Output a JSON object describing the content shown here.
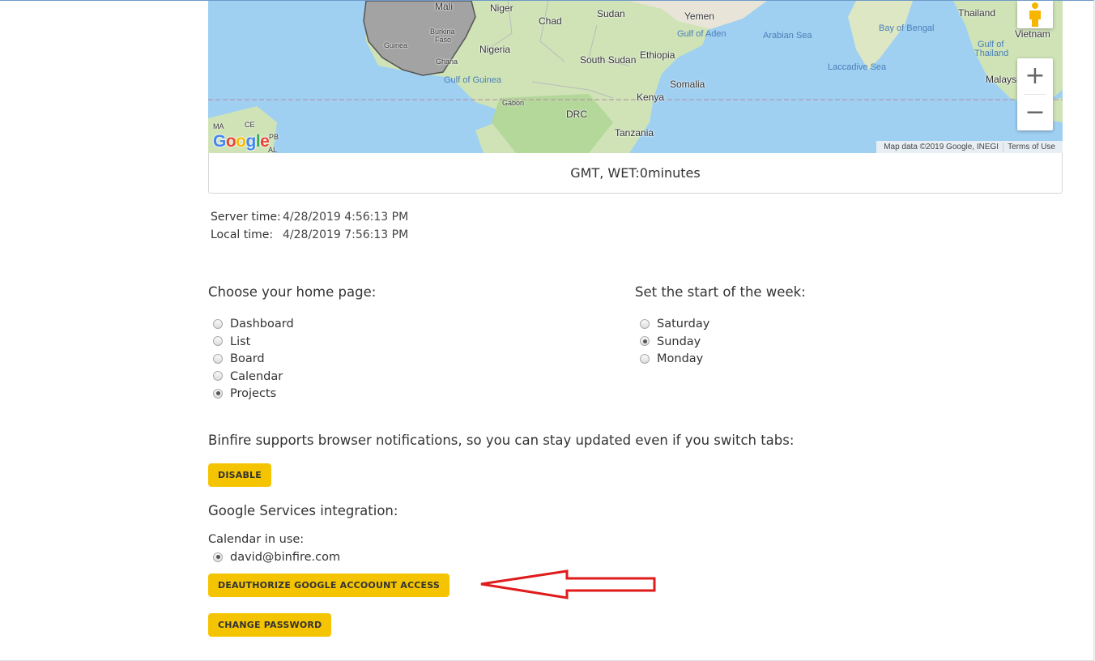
{
  "map": {
    "labels": {
      "mali": "Mali",
      "niger": "Niger",
      "chad": "Chad",
      "sudan": "Sudan",
      "yemen": "Yemen",
      "thailand": "Thailand",
      "gulf_aden": "Gulf of Aden",
      "arabian_sea": "Arabian Sea",
      "bay_bengal": "Bay of Bengal",
      "vietnam": "Vietnam",
      "guinea": "Guinea",
      "burkina": "Burkina",
      "faso": "Faso",
      "nigeria": "Nigeria",
      "ghana": "Ghana",
      "south_sudan": "South Sudan",
      "ethiopia": "Ethiopia",
      "gulf_thailand": "Gulf of",
      "gulf_thailand2": "Thailand",
      "laccadive": "Laccadive Sea",
      "gulf_guinea": "Gulf of Guinea",
      "somalia": "Somalia",
      "malaysia": "Malaysia",
      "gabon": "Gabon",
      "kenya": "Kenya",
      "drc": "DRC",
      "tanzania": "Tanzania",
      "ma": "MA",
      "ce": "CE",
      "pb": "PB",
      "al": "AL"
    },
    "google_logo": [
      "G",
      "o",
      "o",
      "g",
      "l",
      "e"
    ],
    "logo_colors": [
      "#4285F4",
      "#EA4335",
      "#FBBC05",
      "#4285F4",
      "#34A853",
      "#EA4335"
    ],
    "zoom_in": "+",
    "zoom_out": "−",
    "attribution": "Map data ©2019 Google, INEGI",
    "terms": "Terms of Use"
  },
  "timezone": {
    "label": "GMT, WET:0minutes"
  },
  "times": {
    "server_label": "Server time:",
    "server_value": "4/28/2019 4:56:13 PM",
    "local_label": "Local time:",
    "local_value": "4/28/2019 7:56:13 PM"
  },
  "home_page": {
    "title": "Choose your home page:",
    "options": [
      "Dashboard",
      "List",
      "Board",
      "Calendar",
      "Projects"
    ],
    "selected": "Projects"
  },
  "week_start": {
    "title": "Set the start of the week:",
    "options": [
      "Saturday",
      "Sunday",
      "Monday"
    ],
    "selected": "Sunday"
  },
  "notifications": {
    "text": "Binfire supports browser notifications, so you can stay updated even if you switch tabs:",
    "button": "DISABLE"
  },
  "google": {
    "title": "Google Services integration:",
    "calendar_label": "Calendar in use:",
    "account": "david@binfire.com",
    "deauth_button": "DEAUTHORIZE GOOGLE ACCOOUNT ACCESS"
  },
  "password": {
    "button": "CHANGE PASSWORD"
  },
  "colors": {
    "accent": "#f5c400",
    "annotation_arrow": "#e01b1b",
    "ocean": "#9fd0f2"
  }
}
